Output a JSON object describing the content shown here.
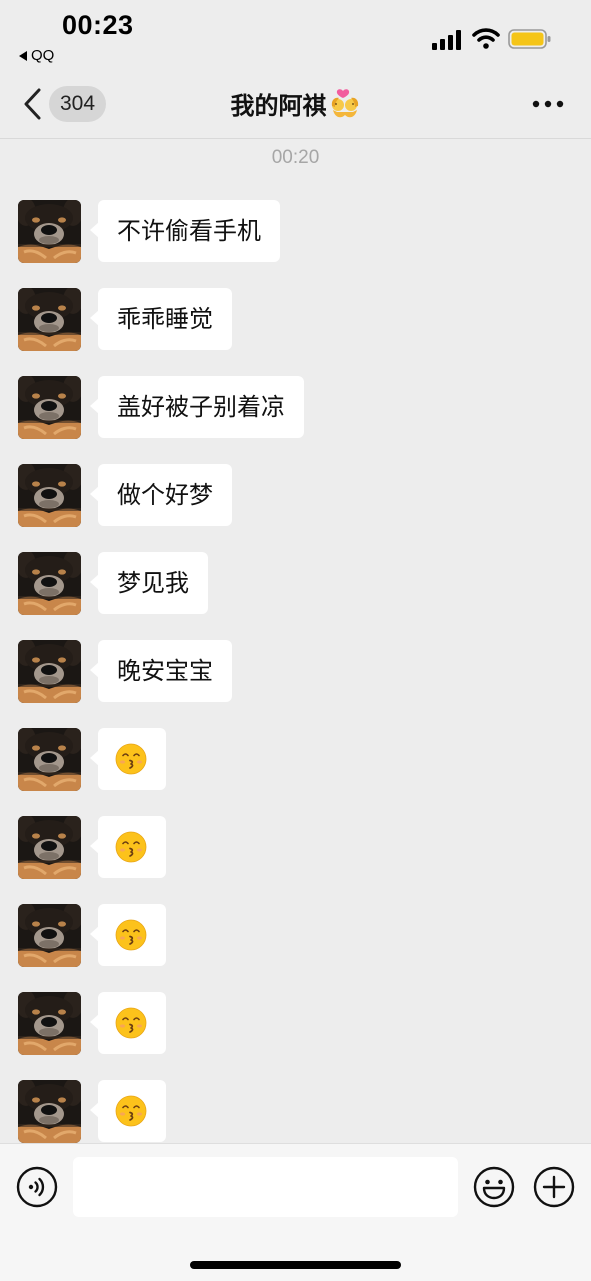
{
  "status_bar": {
    "time": "00:23",
    "back_app": "QQ",
    "icons": [
      "signal-icon",
      "wifi-icon",
      "battery-icon"
    ],
    "battery_color": "#f5c518"
  },
  "nav": {
    "back_icon": "chevron-left-icon",
    "unread_count": "304",
    "title": "我的阿祺",
    "title_emoji": "couple-with-heart-emoji",
    "more_icon": "more-dots-icon"
  },
  "chat": {
    "timestamp": "00:20",
    "messages": [
      {
        "type": "text",
        "text": "不许偷看手机"
      },
      {
        "type": "text",
        "text": "乖乖睡觉"
      },
      {
        "type": "text",
        "text": "盖好被子别着凉"
      },
      {
        "type": "text",
        "text": "做个好梦"
      },
      {
        "type": "text",
        "text": "梦见我"
      },
      {
        "type": "text",
        "text": "晚安宝宝"
      },
      {
        "type": "emoji",
        "emoji": "kissing-face-with-smiling-eyes"
      },
      {
        "type": "emoji",
        "emoji": "kissing-face-with-smiling-eyes"
      },
      {
        "type": "emoji",
        "emoji": "kissing-face-with-smiling-eyes"
      },
      {
        "type": "emoji",
        "emoji": "kissing-face-with-smiling-eyes"
      },
      {
        "type": "emoji",
        "emoji": "kissing-face-with-smiling-eyes"
      }
    ]
  },
  "input_bar": {
    "input_value": "",
    "icons": [
      "voice-icon",
      "emoji-icon",
      "plus-icon"
    ]
  },
  "colors": {
    "background": "#ededed",
    "bubble": "#ffffff",
    "input_bar": "#f6f6f6"
  }
}
